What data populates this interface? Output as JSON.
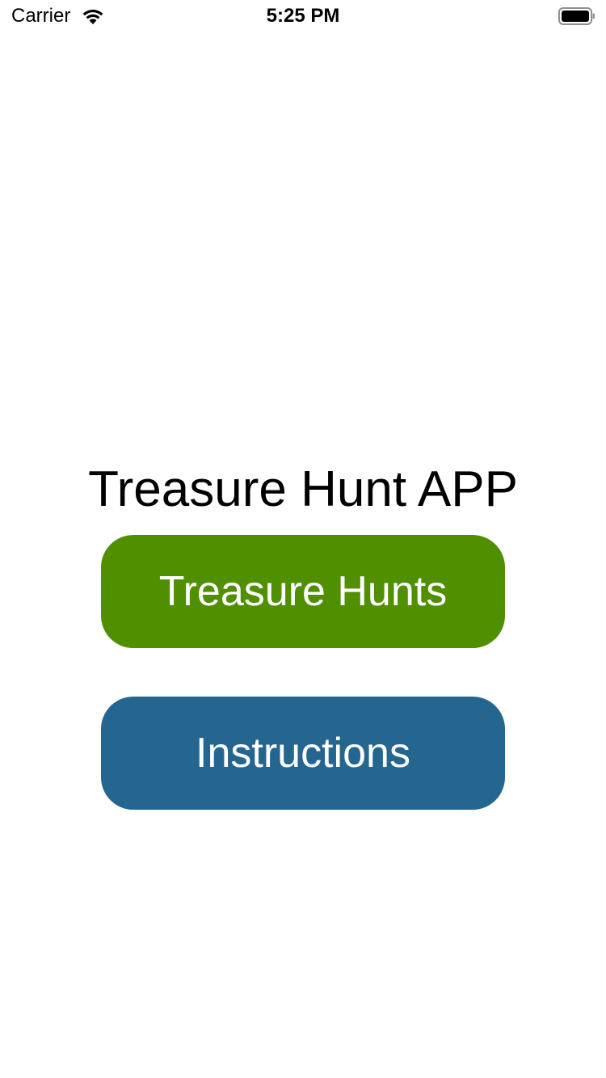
{
  "status_bar": {
    "carrier": "Carrier",
    "time": "5:25 PM",
    "wifi_icon": "wifi-icon",
    "battery_icon": "battery-icon",
    "battery_level": 1.0
  },
  "main": {
    "title": "Treasure Hunt APP",
    "treasure_hunts_label": "Treasure Hunts",
    "instructions_label": "Instructions"
  },
  "colors": {
    "treasure_hunts_button": "#4f8f00",
    "instructions_button": "#246690",
    "background": "#ffffff",
    "text": "#000000"
  }
}
